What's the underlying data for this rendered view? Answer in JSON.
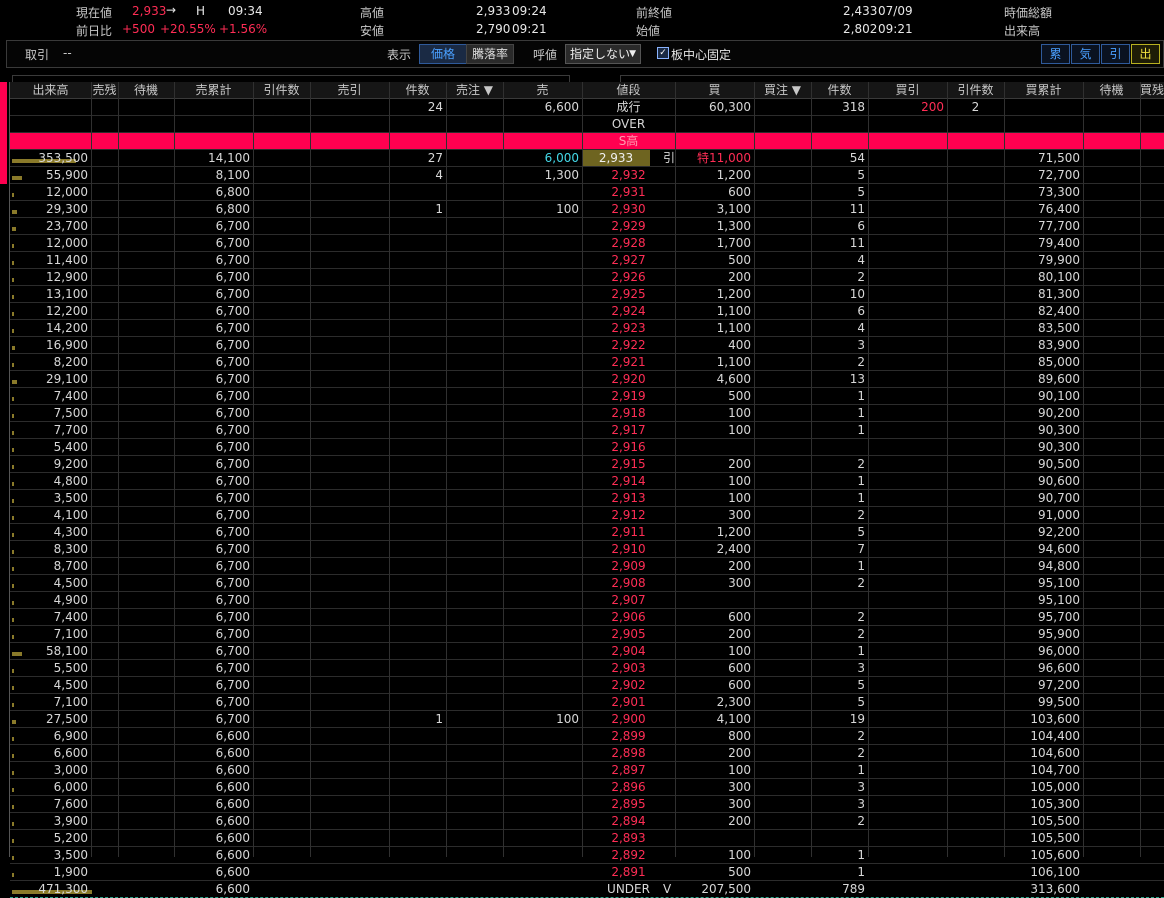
{
  "header": {
    "current_price_label": "現在値",
    "current_price": "2,933",
    "current_arrow": "→",
    "current_flag": "H",
    "current_time": "09:34",
    "prev_diff_label": "前日比",
    "diff_value": "+500",
    "diff_pct": "+20.55%",
    "diff_pct2": "+1.56%",
    "high_label": "高値",
    "high_value": "2,933",
    "high_time": "09:24",
    "low_label": "安値",
    "low_value": "2,790",
    "low_time": "09:21",
    "prev_close_label": "前終値",
    "prev_close_value": "2,433",
    "prev_close_date": "07/09",
    "open_label": "始値",
    "open_value": "2,802",
    "open_time": "09:21",
    "market_cap_label": "時価総額",
    "volume_label": "出来高"
  },
  "controls": {
    "trade_label": "取引",
    "trade_value": "--",
    "display_label": "表示",
    "mode_price": "価格",
    "mode_rate": "騰落率",
    "tick_label": "呼値",
    "tick_value": "指定しない",
    "center_fix_label": "板中心固定",
    "right_buttons": [
      "累",
      "気",
      "引",
      "出"
    ]
  },
  "colors": {
    "accent_red": "#ff0050",
    "price_red": "#ff2d55",
    "cyan": "#44d9e8",
    "bar": "#8a7a2a"
  },
  "columns": [
    "出来高",
    "売残",
    "待機",
    "売累計",
    "引件数",
    "売引",
    "件数",
    "売注 ▼",
    "売",
    "値段",
    "買",
    "買注 ▼",
    "件数",
    "買引",
    "引件数",
    "買累計",
    "待機",
    "買残"
  ],
  "top_rows": {
    "market": {
      "sell_count": "24",
      "sell_qty": "6,600",
      "price": "成行",
      "buy_qty": "60,300",
      "buy_count": "318",
      "buy_close": "200",
      "buy_close_count": "2"
    },
    "over": "OVER",
    "limit": "S高"
  },
  "rows": [
    {
      "vol": "353,500",
      "sc": "14,100",
      "cnt": "27",
      "sq": "6,000",
      "p": "2,933",
      "mark": "引",
      "bq": "特11,000",
      "bc": "54",
      "bcum": "71,500",
      "bar": 0.16,
      "cur": true
    },
    {
      "vol": "55,900",
      "sc": "8,100",
      "cnt": "4",
      "sq": "1,300",
      "p": "2,932",
      "bq": "1,200",
      "bc": "5",
      "bcum": "72,700",
      "bar": 0.025
    },
    {
      "vol": "12,000",
      "sc": "6,800",
      "p": "2,931",
      "bq": "600",
      "bc": "5",
      "bcum": "73,300",
      "bar": 0.005
    },
    {
      "vol": "29,300",
      "sc": "6,800",
      "cnt": "1",
      "sq": "100",
      "p": "2,930",
      "bq": "3,100",
      "bc": "11",
      "bcum": "76,400",
      "bar": 0.012
    },
    {
      "vol": "23,700",
      "sc": "6,700",
      "p": "2,929",
      "bq": "1,300",
      "bc": "6",
      "bcum": "77,700",
      "bar": 0.01
    },
    {
      "vol": "12,000",
      "sc": "6,700",
      "p": "2,928",
      "bq": "1,700",
      "bc": "11",
      "bcum": "79,400",
      "bar": 0.005
    },
    {
      "vol": "11,400",
      "sc": "6,700",
      "p": "2,927",
      "bq": "500",
      "bc": "4",
      "bcum": "79,900",
      "bar": 0.005
    },
    {
      "vol": "12,900",
      "sc": "6,700",
      "p": "2,926",
      "bq": "200",
      "bc": "2",
      "bcum": "80,100",
      "bar": 0.005
    },
    {
      "vol": "13,100",
      "sc": "6,700",
      "p": "2,925",
      "bq": "1,200",
      "bc": "10",
      "bcum": "81,300",
      "bar": 0.005
    },
    {
      "vol": "12,200",
      "sc": "6,700",
      "p": "2,924",
      "bq": "1,100",
      "bc": "6",
      "bcum": "82,400",
      "bar": 0.005
    },
    {
      "vol": "14,200",
      "sc": "6,700",
      "p": "2,923",
      "bq": "1,100",
      "bc": "4",
      "bcum": "83,500",
      "bar": 0.006
    },
    {
      "vol": "16,900",
      "sc": "6,700",
      "p": "2,922",
      "bq": "400",
      "bc": "3",
      "bcum": "83,900",
      "bar": 0.007
    },
    {
      "vol": "8,200",
      "sc": "6,700",
      "p": "2,921",
      "bq": "1,100",
      "bc": "2",
      "bcum": "85,000",
      "bar": 0.003
    },
    {
      "vol": "29,100",
      "sc": "6,700",
      "p": "2,920",
      "bq": "4,600",
      "bc": "13",
      "bcum": "89,600",
      "bar": 0.012
    },
    {
      "vol": "7,400",
      "sc": "6,700",
      "p": "2,919",
      "bq": "500",
      "bc": "1",
      "bcum": "90,100",
      "bar": 0.003
    },
    {
      "vol": "7,500",
      "sc": "6,700",
      "p": "2,918",
      "bq": "100",
      "bc": "1",
      "bcum": "90,200",
      "bar": 0.003
    },
    {
      "vol": "7,700",
      "sc": "6,700",
      "p": "2,917",
      "bq": "100",
      "bc": "1",
      "bcum": "90,300",
      "bar": 0.003
    },
    {
      "vol": "5,400",
      "sc": "6,700",
      "p": "2,916",
      "bcum": "90,300",
      "bar": 0.002
    },
    {
      "vol": "9,200",
      "sc": "6,700",
      "p": "2,915",
      "bq": "200",
      "bc": "2",
      "bcum": "90,500",
      "bar": 0.004
    },
    {
      "vol": "4,800",
      "sc": "6,700",
      "p": "2,914",
      "bq": "100",
      "bc": "1",
      "bcum": "90,600",
      "bar": 0.002
    },
    {
      "vol": "3,500",
      "sc": "6,700",
      "p": "2,913",
      "bq": "100",
      "bc": "1",
      "bcum": "90,700",
      "bar": 0.0015
    },
    {
      "vol": "4,100",
      "sc": "6,700",
      "p": "2,912",
      "bq": "300",
      "bc": "2",
      "bcum": "91,000",
      "bar": 0.002
    },
    {
      "vol": "4,300",
      "sc": "6,700",
      "p": "2,911",
      "bq": "1,200",
      "bc": "5",
      "bcum": "92,200",
      "bar": 0.002
    },
    {
      "vol": "8,300",
      "sc": "6,700",
      "p": "2,910",
      "bq": "2,400",
      "bc": "7",
      "bcum": "94,600",
      "bar": 0.003
    },
    {
      "vol": "8,700",
      "sc": "6,700",
      "p": "2,909",
      "bq": "200",
      "bc": "1",
      "bcum": "94,800",
      "bar": 0.003
    },
    {
      "vol": "4,500",
      "sc": "6,700",
      "p": "2,908",
      "bq": "300",
      "bc": "2",
      "bcum": "95,100",
      "bar": 0.002
    },
    {
      "vol": "4,900",
      "sc": "6,700",
      "p": "2,907",
      "bcum": "95,100",
      "bar": 0.002
    },
    {
      "vol": "7,400",
      "sc": "6,700",
      "p": "2,906",
      "bq": "600",
      "bc": "2",
      "bcum": "95,700",
      "bar": 0.003
    },
    {
      "vol": "7,100",
      "sc": "6,700",
      "p": "2,905",
      "bq": "200",
      "bc": "2",
      "bcum": "95,900",
      "bar": 0.003
    },
    {
      "vol": "58,100",
      "sc": "6,700",
      "p": "2,904",
      "bq": "100",
      "bc": "1",
      "bcum": "96,000",
      "bar": 0.025
    },
    {
      "vol": "5,500",
      "sc": "6,700",
      "p": "2,903",
      "bq": "600",
      "bc": "3",
      "bcum": "96,600",
      "bar": 0.002
    },
    {
      "vol": "4,500",
      "sc": "6,700",
      "p": "2,902",
      "bq": "600",
      "bc": "5",
      "bcum": "97,200",
      "bar": 0.002
    },
    {
      "vol": "7,100",
      "sc": "6,700",
      "p": "2,901",
      "bq": "2,300",
      "bc": "5",
      "bcum": "99,500",
      "bar": 0.003
    },
    {
      "vol": "27,500",
      "sc": "6,700",
      "cnt": "1",
      "sq": "100",
      "p": "2,900",
      "bq": "4,100",
      "bc": "19",
      "bcum": "103,600",
      "bar": 0.011
    },
    {
      "vol": "6,900",
      "sc": "6,600",
      "p": "2,899",
      "bq": "800",
      "bc": "2",
      "bcum": "104,400",
      "bar": 0.003
    },
    {
      "vol": "6,600",
      "sc": "6,600",
      "p": "2,898",
      "bq": "200",
      "bc": "2",
      "bcum": "104,600",
      "bar": 0.003
    },
    {
      "vol": "3,000",
      "sc": "6,600",
      "p": "2,897",
      "bq": "100",
      "bc": "1",
      "bcum": "104,700",
      "bar": 0.0015
    },
    {
      "vol": "6,000",
      "sc": "6,600",
      "p": "2,896",
      "bq": "300",
      "bc": "3",
      "bcum": "105,000",
      "bar": 0.003
    },
    {
      "vol": "7,600",
      "sc": "6,600",
      "p": "2,895",
      "bq": "300",
      "bc": "3",
      "bcum": "105,300",
      "bar": 0.003
    },
    {
      "vol": "3,900",
      "sc": "6,600",
      "p": "2,894",
      "bq": "200",
      "bc": "2",
      "bcum": "105,500",
      "bar": 0.0015
    },
    {
      "vol": "5,200",
      "sc": "6,600",
      "p": "2,893",
      "bcum": "105,500",
      "bar": 0.002
    },
    {
      "vol": "3,500",
      "sc": "6,600",
      "p": "2,892",
      "bq": "100",
      "bc": "1",
      "bcum": "105,600",
      "bar": 0.0015
    },
    {
      "vol": "1,900",
      "sc": "6,600",
      "p": "2,891",
      "bq": "500",
      "bc": "1",
      "bcum": "106,100",
      "bar": 0.001
    }
  ],
  "under_row": {
    "vol": "471,300",
    "sc": "6,600",
    "p": "UNDER",
    "mark": "V",
    "bq": "207,500",
    "bc": "789",
    "bcum": "313,600",
    "bar": 0.2
  }
}
